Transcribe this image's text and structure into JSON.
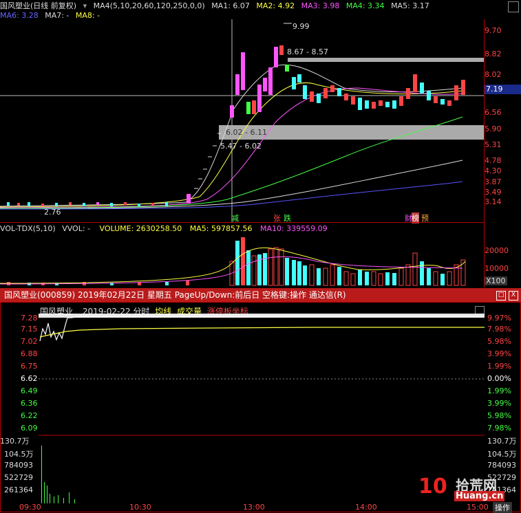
{
  "kline": {
    "title": "国风塑业(日线 前复权)",
    "ma4_params": "MA4(5,10,20,60,120,250,0,0)",
    "ma1": "MA1: 6.07",
    "ma2": "MA2: 4.92",
    "ma3": "MA3: 3.98",
    "ma4": "MA4: 3.34",
    "ma5": "MA5: 3.17",
    "ma6": "MA6: 3.28",
    "ma7": "MA7: -",
    "ma8": "MA8: -",
    "price_axis": [
      "9.70",
      "8.82",
      "8.02",
      "6.56",
      "5.90",
      "5.31",
      "4.78",
      "4.30",
      "3.87",
      "3.49",
      "3.14"
    ],
    "current_price": "7.19",
    "high_label": "9.99",
    "low_label": "2.76",
    "gap1": "8.67 - 8.57",
    "gap2": "6.02 - 6.11",
    "gap3": "5.47 - 6.02",
    "mark_reduce": "减",
    "mark_limit_up": "张",
    "mark_fall": "跌",
    "mark_fin": "财",
    "mark_list": "榜",
    "mark_pre": "预"
  },
  "volume": {
    "title": "VOL-TDX(5,10)",
    "vvol": "VVOL: -",
    "volume": "VOLUME: 2630258.50",
    "ma5": "MA5: 597857.56",
    "ma10": "MA10: 339559.09",
    "axis": [
      "20000",
      "10000"
    ],
    "unit": "X100"
  },
  "intraday_window": {
    "title": "国风塑业(000859)  2019年02月22日  星期五  PageUp/Down:前后日  空格键:操作  通达信(R)",
    "maximize": "□",
    "close": "X",
    "stock": "国风塑业",
    "date_label": "2019-02-22 分时",
    "avg_label": "均线",
    "vol_label": "成交量",
    "limit_label": "涨停板坐标",
    "prices_up": [
      "7.28",
      "7.15",
      "7.02",
      "6.88",
      "6.75"
    ],
    "price_mid": "6.62",
    "prices_down": [
      "6.49",
      "6.36",
      "6.22",
      "6.09"
    ],
    "pct_up": [
      "9.97%",
      "7.98%",
      "5.98%",
      "3.99%",
      "1.99%"
    ],
    "pct_mid": "0.00%",
    "pct_down": [
      "1.99%",
      "3.99%",
      "5.98%",
      "7.98%"
    ],
    "vol_axis_left": [
      "130.7万",
      "104.5万",
      "784093",
      "522729",
      "261364"
    ],
    "vol_axis_right": [
      "130.7万",
      "104.5万",
      "784093",
      "522729",
      "261364"
    ],
    "time_axis": [
      "09:30",
      "10:30",
      "13:00",
      "14:00",
      "15:00"
    ],
    "bottom_right": "操作",
    "watermark_num": "10",
    "watermark_cn": "拾荒网",
    "watermark_en": "Huang.cn"
  },
  "colors": {
    "red": "#ff3c3c",
    "cyan": "#44ffff",
    "yellow": "#ffff44",
    "magenta": "#ff55ff",
    "green": "#44ff44",
    "blue": "#6666ff",
    "titlebar": "#b91b1b"
  }
}
